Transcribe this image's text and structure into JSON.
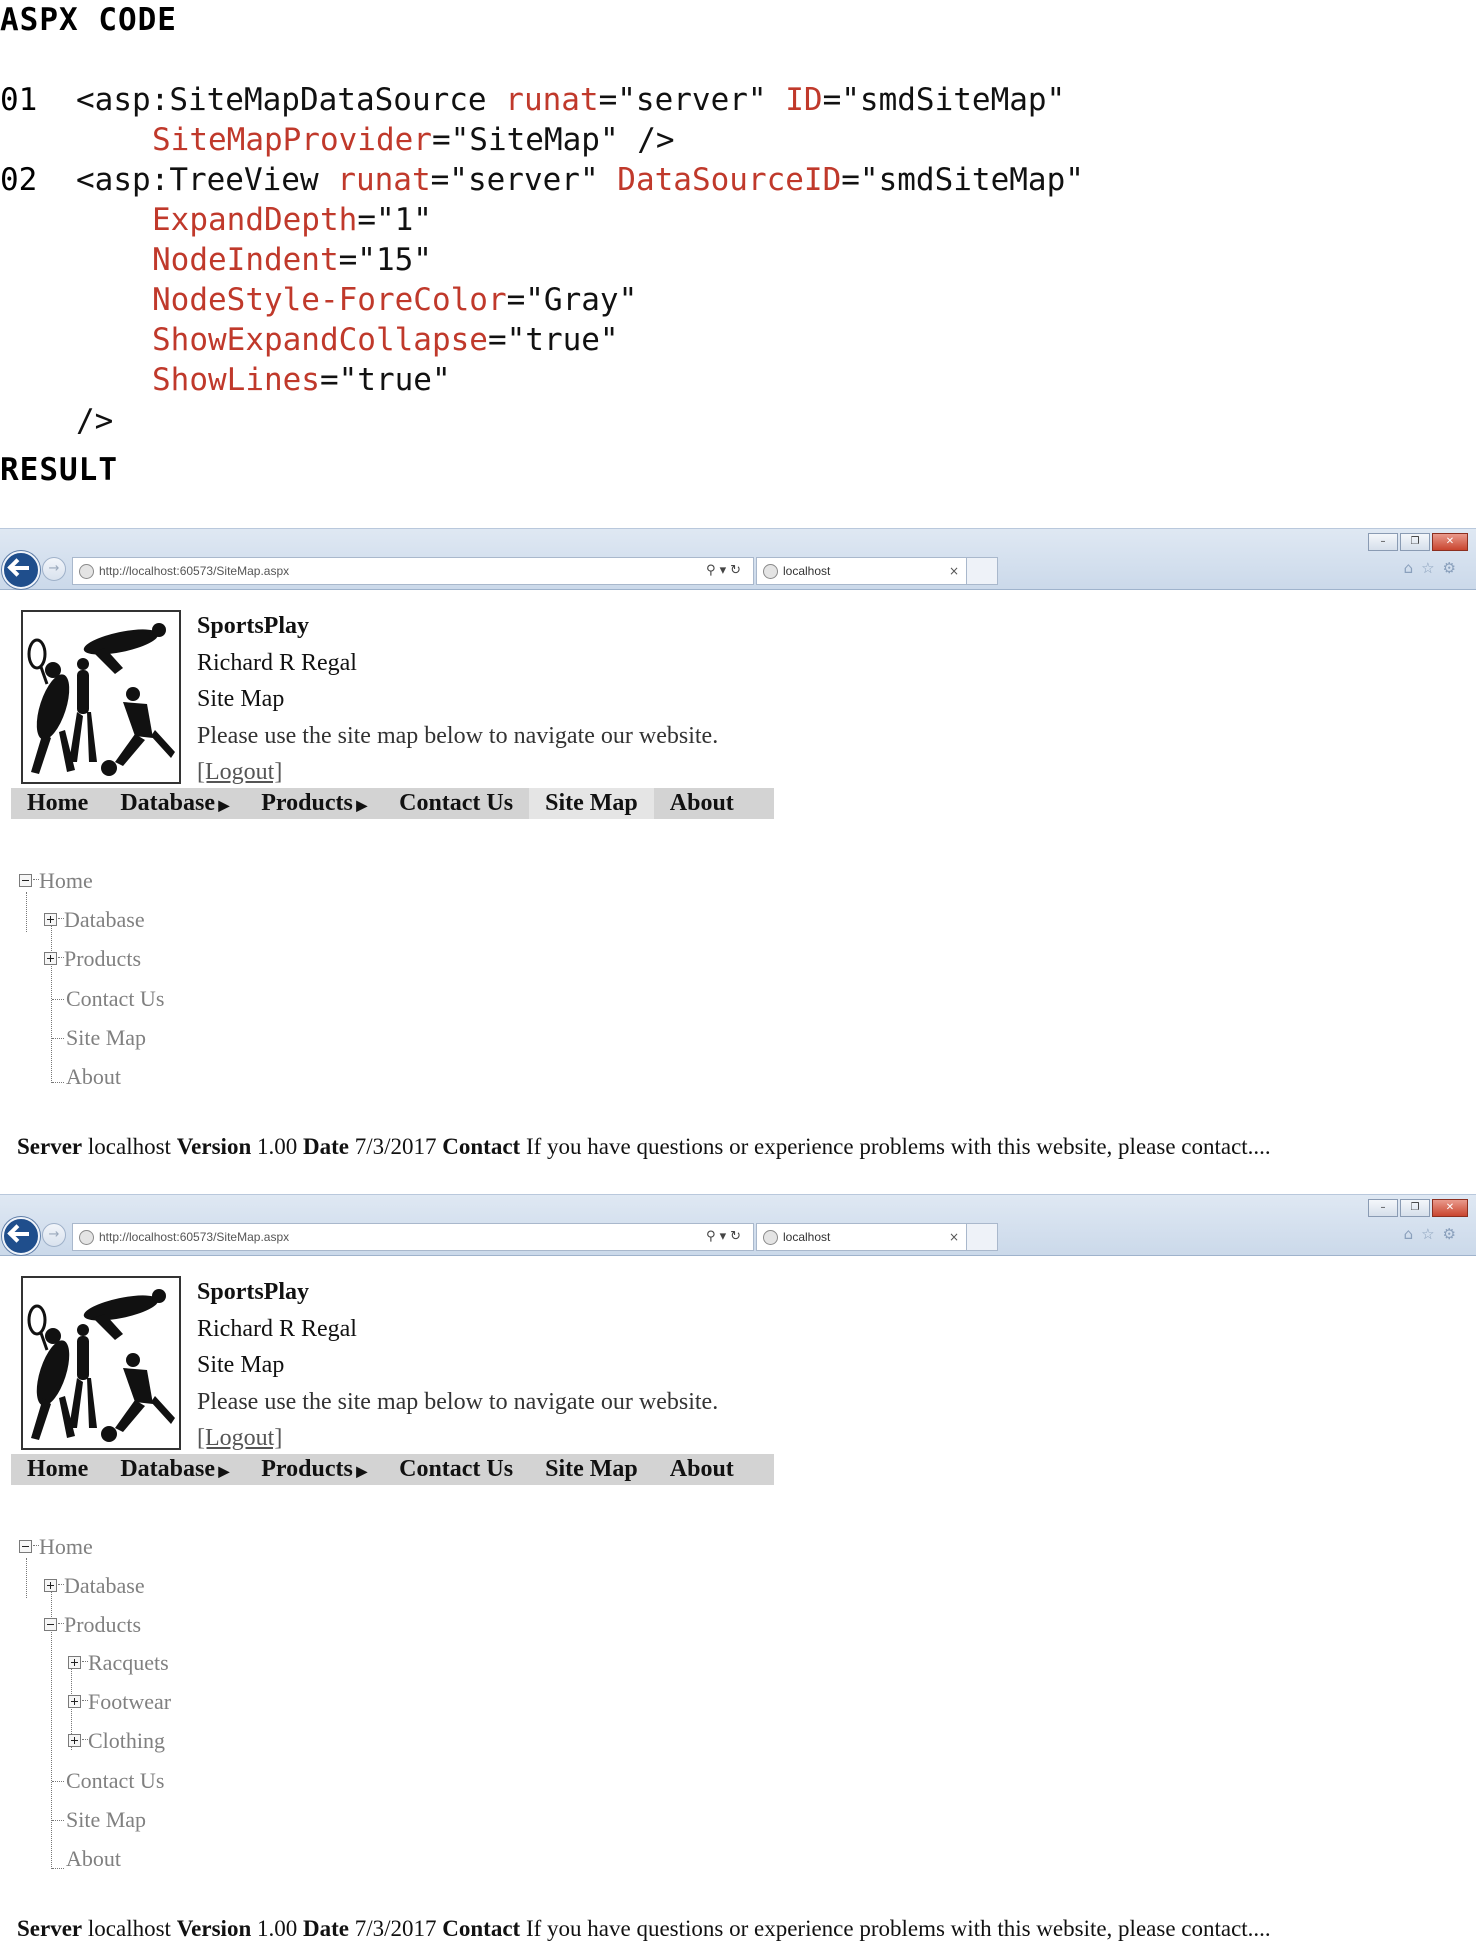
{
  "code": {
    "heading": "ASPX CODE",
    "result_heading": "RESULT",
    "line1_num": "01",
    "line1_a": "<asp:SiteMapDataSource",
    "line1_b_attr": "runat",
    "line1_b_val": "=\"server\"",
    "line1_c_attr": "ID",
    "line1_c_val": "=\"smdSiteMap\"",
    "line1_d_attr": "SiteMapProvider",
    "line1_d_val": "=\"SiteMap\" />",
    "line2_num": "02",
    "line2_a": "<asp:TreeView",
    "line2_b_attr": "runat",
    "line2_b_val": "=\"server\"",
    "line2_c_attr": "DataSourceID",
    "line2_c_val": "=\"smdSiteMap\"",
    "attrs": [
      {
        "name": "ExpandDepth",
        "val": "=\"1\""
      },
      {
        "name": "NodeIndent",
        "val": "=\"15\""
      },
      {
        "name": "NodeStyle-ForeColor",
        "val": "=\"Gray\""
      },
      {
        "name": "ShowExpandCollapse",
        "val": "=\"true\""
      },
      {
        "name": "ShowLines",
        "val": "=\"true\""
      }
    ],
    "close": "/>"
  },
  "browser": {
    "url": "http://localhost:60573/SiteMap.aspx",
    "tab_title": "localhost"
  },
  "header": {
    "site": "SportsPlay",
    "user": "Richard R Regal",
    "page": "Site Map",
    "intro": "Please use the site map below to navigate our website.",
    "logout": "[Logout]"
  },
  "menu": {
    "items": [
      "Home",
      "Database",
      "Products",
      "Contact Us",
      "Site Map",
      "About"
    ]
  },
  "tree1": {
    "root": "Home",
    "children": [
      "Database",
      "Products",
      "Contact Us",
      "Site Map",
      "About"
    ]
  },
  "tree2": {
    "root": "Home",
    "children": [
      "Database",
      "Products",
      "Contact Us",
      "Site Map",
      "About"
    ],
    "products_children": [
      "Racquets",
      "Footwear",
      "Clothing"
    ]
  },
  "footer": {
    "server_label": "Server",
    "server": "localhost",
    "version_label": "Version",
    "version": "1.00",
    "date_label": "Date",
    "date": "7/3/2017",
    "contact_label": "Contact",
    "contact": "If you have questions or experience problems with this website, please contact...."
  }
}
